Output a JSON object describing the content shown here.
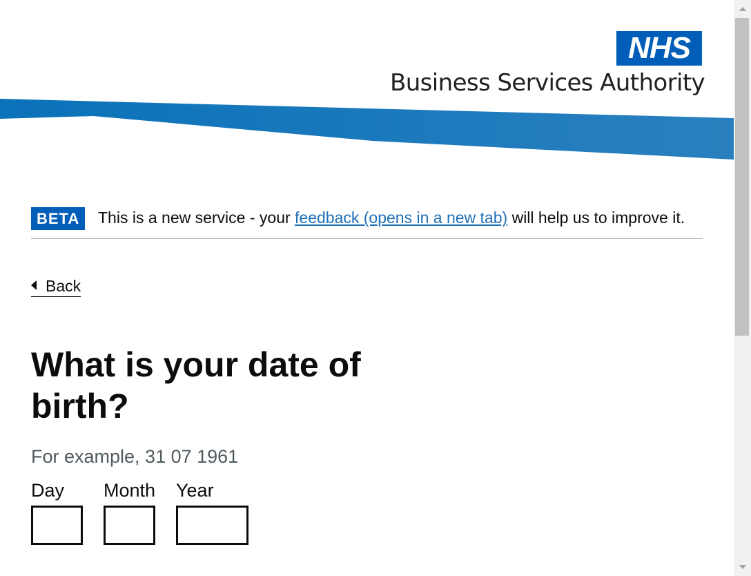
{
  "header": {
    "logo_text": "NHS",
    "org_name": "Business Services Authority",
    "brand_color": "#005eb8",
    "swoosh_color": "#1a72b8"
  },
  "beta_banner": {
    "tag": "BETA",
    "text_before": "This is a new service - your ",
    "link_text": "feedback (opens in a new tab)",
    "text_after": " will help us to improve it."
  },
  "back_link": {
    "label": "Back"
  },
  "question": {
    "title": "What is your date of birth?",
    "hint": "For example, 31 07 1961"
  },
  "date_fields": {
    "day": {
      "label": "Day",
      "value": ""
    },
    "month": {
      "label": "Month",
      "value": ""
    },
    "year": {
      "label": "Year",
      "value": ""
    }
  },
  "icons": {
    "back": "chevron-left-icon",
    "scroll_up": "scroll-up-arrow-icon",
    "scroll_down": "scroll-down-arrow-icon"
  }
}
